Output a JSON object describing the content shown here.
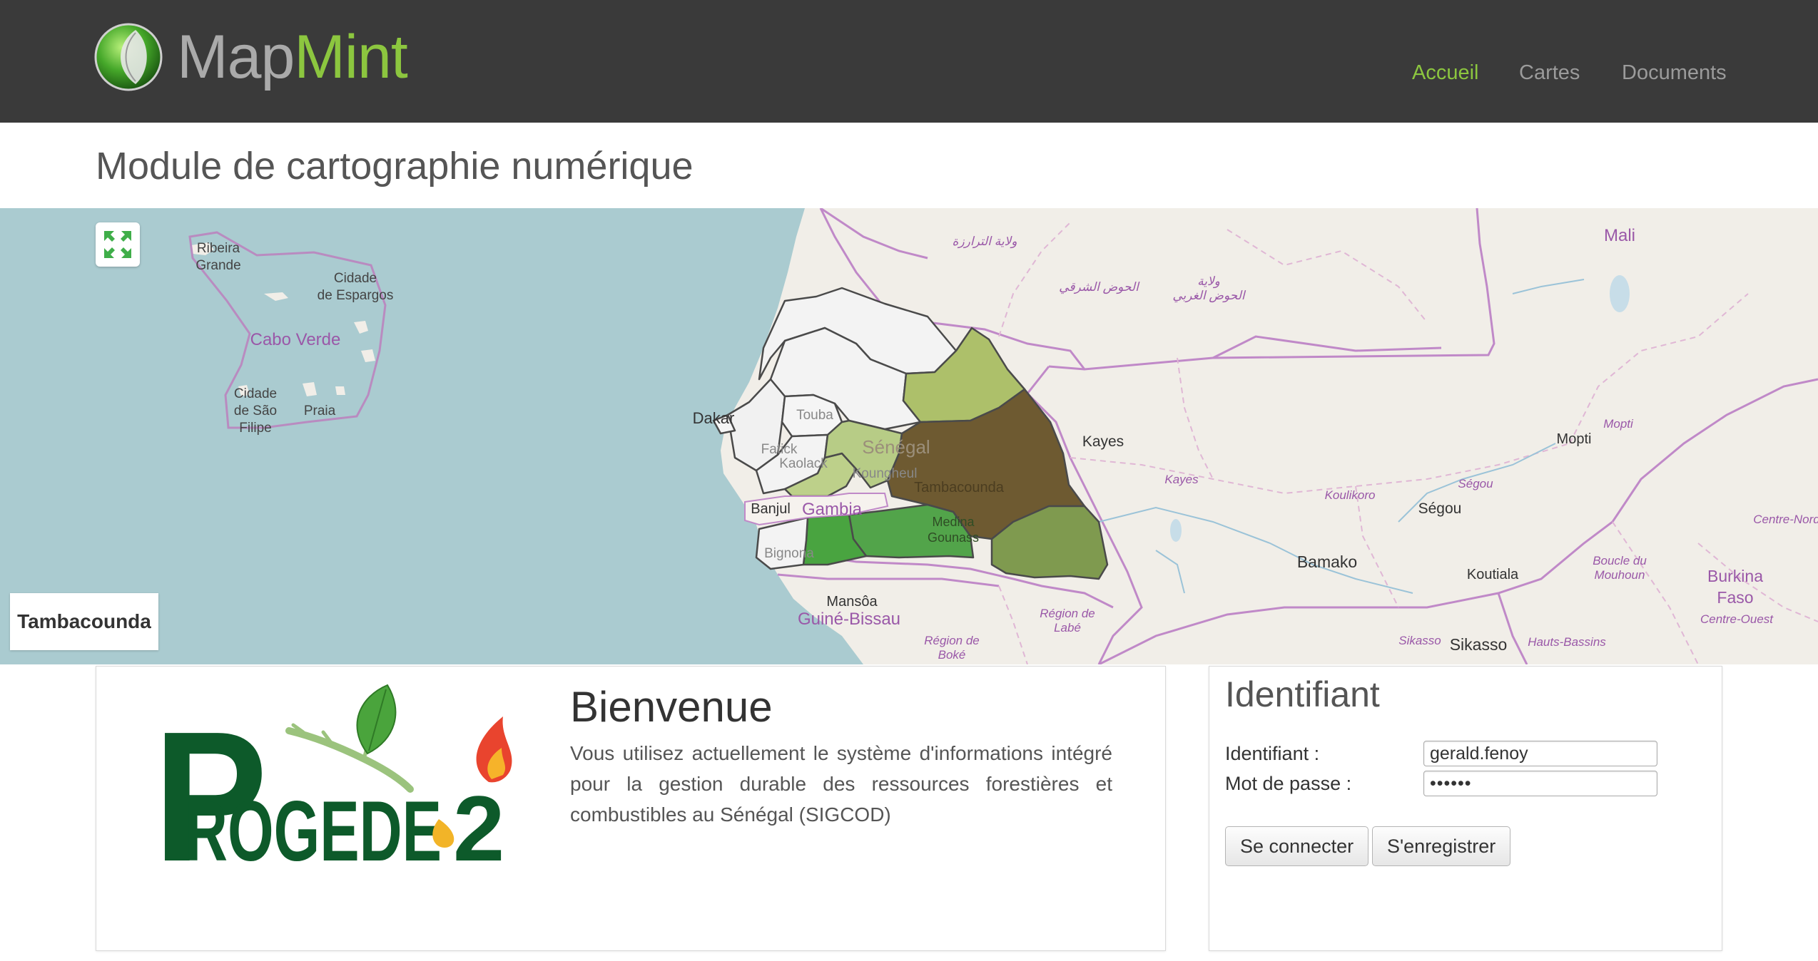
{
  "header": {
    "logo_part1": "Map",
    "logo_part2": "Mint",
    "nav": [
      {
        "label": "Accueil",
        "active": true
      },
      {
        "label": "Cartes",
        "active": false
      },
      {
        "label": "Documents",
        "active": false
      }
    ]
  },
  "page_title": "Module de cartographie numérique",
  "map": {
    "selected_region": "Tambacounda",
    "labels": {
      "ribeira": [
        "Ribeira",
        "Grande"
      ],
      "espargos": [
        "Cidade",
        "de Espargos"
      ],
      "cabo_verde": "Cabo Verde",
      "sao_filipe": [
        "Cidade",
        "de São",
        "Filipe"
      ],
      "praia": "Praia",
      "dakar": "Dakar",
      "touba": "Touba",
      "fatick": "Fatick",
      "kaolack": "Kaolack",
      "senegal": "Sénégal",
      "koungheul": "Koungheul",
      "tambacounda": "Tambacounda",
      "banjul": "Banjul",
      "gambia": "Gambia",
      "medina": [
        "Medina",
        "Gounass"
      ],
      "bignona": "Bignona",
      "mansoa": "Mansôa",
      "guine": "Guiné-Bissau",
      "labe": [
        "Région de",
        "Labé"
      ],
      "boke": [
        "Région de",
        "Boké"
      ],
      "kayes": "Kayes",
      "kayes_region": "Kayes",
      "koulikoro": "Koulikoro",
      "segou_region": "Ségou",
      "segou": "Ségou",
      "bamako": "Bamako",
      "koutiala": "Koutiala",
      "sikasso_region": "Sikasso",
      "sikasso": "Sikasso",
      "hauts_bassins": "Hauts-Bassins",
      "boucle": [
        "Boucle du",
        "Mouhoun"
      ],
      "burkina": [
        "Burkina",
        "Faso"
      ],
      "centre_ouest": "Centre-Ouest",
      "centre_nord": "Centre-Nord",
      "mopti": "Mopti",
      "mopti_region": "Mopti",
      "mali": "Mali",
      "trarza": "ولاية الترارزة",
      "hodh_charghi": "الحوض الشرقي",
      "hodh_gharbi": [
        "ولاية",
        "الحوض الغربي"
      ]
    }
  },
  "welcome": {
    "title": "Bienvenue",
    "text": "Vous utilisez actuellement le système d'informations intégré pour la gestion durable des ressources forestières et combustibles au Sénégal (SIGCOD)",
    "logo_letters": [
      "P",
      "ROGEDE",
      "2"
    ]
  },
  "login": {
    "title": "Identifiant",
    "username_label": "Identifiant :",
    "username_value": "gerald.fenoy",
    "password_label": "Mot de passe :",
    "password_value": "••••••",
    "connect_label": "Se connecter",
    "register_label": "S'enregistrer"
  },
  "colors": {
    "header_bg": "#3a3a3a",
    "brand_green": "#8cc63f",
    "sea": "#aacbd0",
    "land": "#f1eee8",
    "border_purple": "#c089c8"
  }
}
